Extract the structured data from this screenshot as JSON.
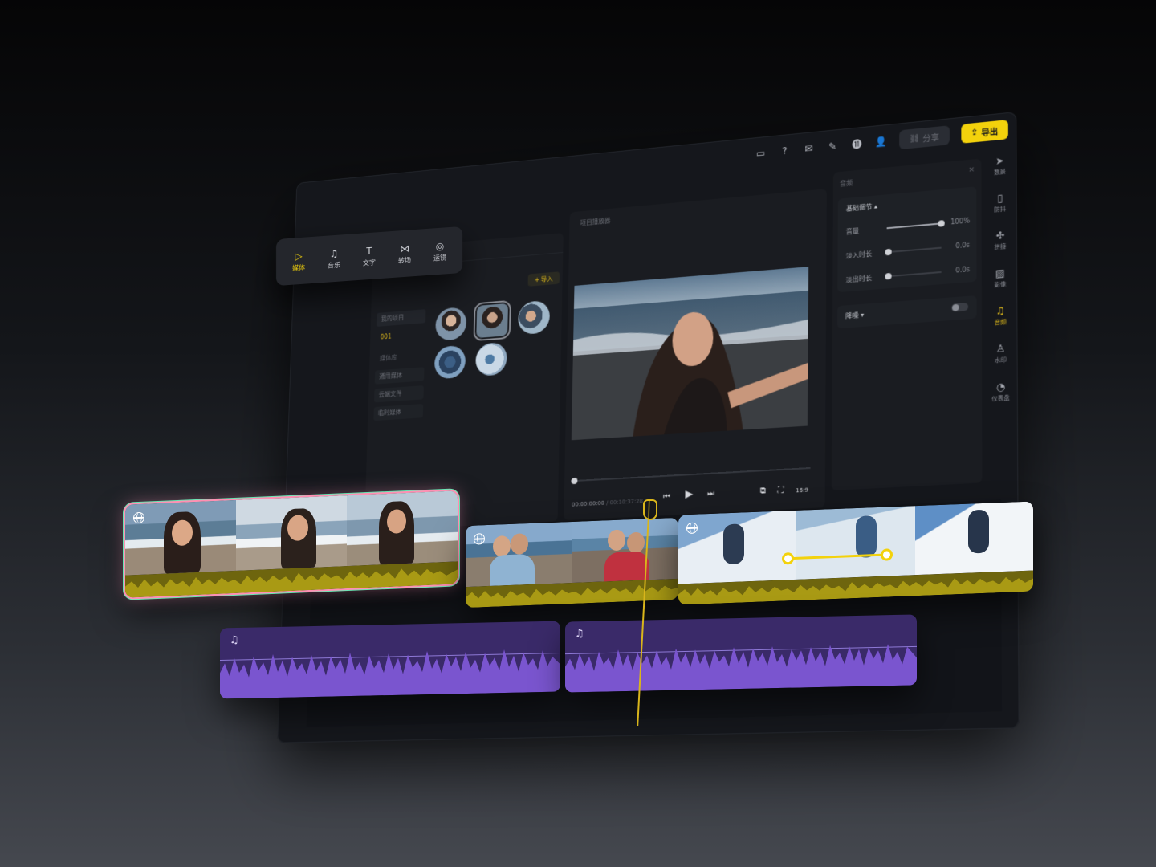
{
  "topbar": {
    "icons": [
      "subtitle-icon",
      "help-icon",
      "mail-icon",
      "edit-icon",
      "counter-icon",
      "user-icon"
    ],
    "share_label": "分享",
    "export_label": "导出"
  },
  "media_tabs": [
    {
      "icon": "folder-play-icon",
      "label": "媒体",
      "active": true
    },
    {
      "icon": "music-note-icon",
      "label": "音乐",
      "active": false
    },
    {
      "icon": "text-icon",
      "label": "文字",
      "active": false
    },
    {
      "icon": "transition-icon",
      "label": "转场",
      "active": false
    },
    {
      "icon": "camera-move-icon",
      "label": "运镜",
      "active": false
    }
  ],
  "left_panel": {
    "import_label": "导入",
    "project_header": "我的项目",
    "project_item": "001",
    "library_header": "媒体库",
    "library_items": [
      "通用媒体",
      "云端文件",
      "临时媒体"
    ]
  },
  "viewer": {
    "title": "项目播放器",
    "time_current": "00:00:00:00",
    "time_total": "/ 00:10:37:28",
    "aspect": "16:9"
  },
  "audio_panel": {
    "title": "音频",
    "section": "基础调节",
    "rows": [
      {
        "label": "音量",
        "value": "100%",
        "level": 1.0
      },
      {
        "label": "淡入时长",
        "value": "0.0s",
        "level": 0.0
      },
      {
        "label": "淡出时长",
        "value": "0.0s",
        "level": 0.0
      }
    ],
    "denoise_label": "降噪",
    "denoise_on": false
  },
  "right_rail": [
    {
      "icon": "send-icon",
      "label": "数景",
      "active": false
    },
    {
      "icon": "stabilize-icon",
      "label": "防抖",
      "active": false
    },
    {
      "icon": "puzzle-icon",
      "label": "拼接",
      "active": false
    },
    {
      "icon": "image-icon",
      "label": "影像",
      "active": false
    },
    {
      "icon": "audio-icon",
      "label": "音频",
      "active": true
    },
    {
      "icon": "stamp-icon",
      "label": "水印",
      "active": false
    },
    {
      "icon": "gauge-icon",
      "label": "仪表盘",
      "active": false
    }
  ],
  "colors": {
    "accent": "#f3d20c",
    "audio_track": "#3a2a69",
    "audio_wave": "#7a55cf",
    "clip_wave": "#9b8a10"
  }
}
